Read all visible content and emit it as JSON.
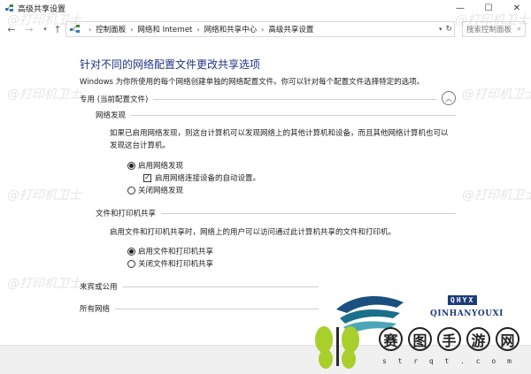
{
  "window": {
    "title": "高级共享设置"
  },
  "nav": {
    "breadcrumb": [
      "控制面板",
      "网络和 Internet",
      "网络和共享中心",
      "高级共享设置"
    ],
    "search_placeholder": "搜索控制面板"
  },
  "main": {
    "heading": "针对不同的网络配置文件更改共享选项",
    "subtext": "Windows 为你所使用的每个网络创建单独的网络配置文件。你可以针对每个配置文件选择特定的选项。",
    "private_label": "专用 (当前配置文件)",
    "network_discovery": {
      "title": "网络发现",
      "description": "如果已启用网络发现，则这台计算机可以发现网络上的其他计算机和设备，而且其他网络计算机也可以发现这台计算机。",
      "on_label": "启用网络发现",
      "auto_setup_label": "启用网络连接设备的自动设置。",
      "off_label": "关闭网络发现"
    },
    "file_printer": {
      "title": "文件和打印机共享",
      "description": "启用文件和打印机共享时，网络上的用户可以访问通过此计算机共享的文件和打印机。",
      "on_label": "启用文件和打印机共享",
      "off_label": "关闭文件和打印机共享"
    },
    "guest_label": "来宾或公用",
    "all_networks_label": "所有网络"
  },
  "watermark": {
    "text": "@打印机卫士"
  },
  "logos": {
    "brand1": "QINHANYOUXI",
    "brand1_short": "QHYX",
    "brand2_chars": [
      "赛",
      "图",
      "手",
      "游",
      "网"
    ],
    "brand2_sub": "s t r q t . c o m"
  },
  "colors": {
    "heading": "#1e3287",
    "brand_green": "#9ccc2c",
    "brand_teal": "#1a6f8a"
  }
}
